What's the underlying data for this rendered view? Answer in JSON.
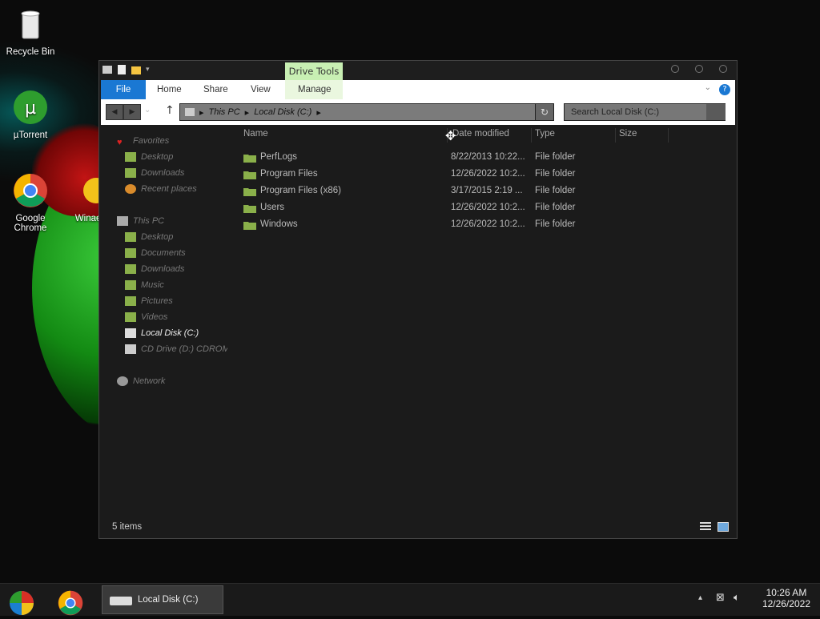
{
  "desktop": {
    "icons": [
      {
        "label": "Recycle Bin"
      },
      {
        "label": "µTorrent"
      },
      {
        "label": "Google Chrome"
      },
      {
        "label": "Winaer"
      }
    ]
  },
  "window": {
    "contextual_tab_group": "Drive Tools",
    "ribbon_tabs": [
      "File",
      "Home",
      "Share",
      "View",
      "Manage"
    ],
    "help_label": "?",
    "address": {
      "segments": [
        "This PC",
        "Local Disk (C:)"
      ]
    },
    "search": {
      "placeholder": "Search Local Disk (C:)"
    },
    "nav_pane": {
      "favorites": {
        "label": "Favorites",
        "items": [
          "Desktop",
          "Downloads",
          "Recent places"
        ]
      },
      "this_pc": {
        "label": "This PC",
        "items": [
          "Desktop",
          "Documents",
          "Downloads",
          "Music",
          "Pictures",
          "Videos",
          "Local Disk (C:)",
          "CD Drive (D:) CDROM"
        ]
      },
      "network": {
        "label": "Network"
      },
      "selected": "Local Disk (C:)"
    },
    "columns": [
      "Name",
      "Date modified",
      "Type",
      "Size"
    ],
    "files": [
      {
        "name": "PerfLogs",
        "date": "8/22/2013 10:22...",
        "type": "File folder"
      },
      {
        "name": "Program Files",
        "date": "12/26/2022 10:2...",
        "type": "File folder"
      },
      {
        "name": "Program Files (x86)",
        "date": "3/17/2015 2:19 ...",
        "type": "File folder"
      },
      {
        "name": "Users",
        "date": "12/26/2022 10:2...",
        "type": "File folder"
      },
      {
        "name": "Windows",
        "date": "12/26/2022 10:2...",
        "type": "File folder"
      }
    ],
    "status": "5 items"
  },
  "taskbar": {
    "active_window": "Local Disk (C:)",
    "time": "10:26 AM",
    "date": "12/26/2022"
  },
  "colors": {
    "accent": "#1a78d3",
    "drive_tools": "#c8efb3",
    "folder": "#8ab04a"
  }
}
